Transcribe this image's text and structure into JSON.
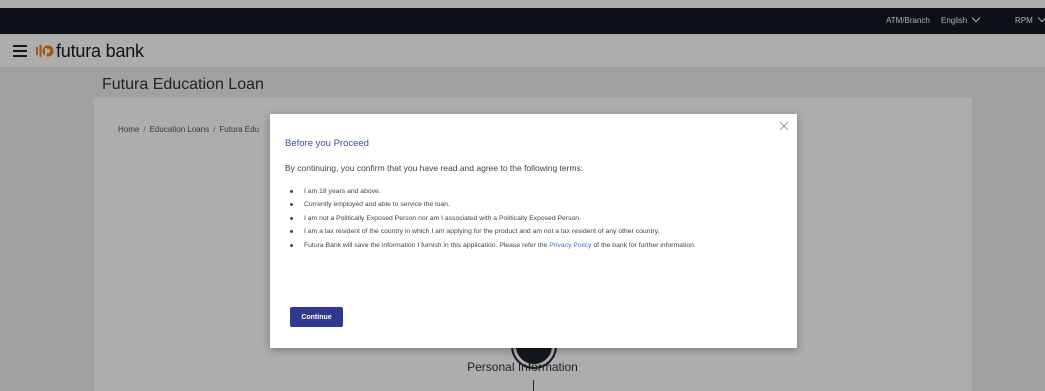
{
  "topbar": {
    "atm_branch": "ATM/Branch",
    "language": "English",
    "user": "RPM"
  },
  "header": {
    "brand": "futura bank"
  },
  "page": {
    "title": "Futura Education Loan",
    "breadcrumb": [
      "Home",
      "Education Loans",
      "Futura Edu"
    ]
  },
  "step": {
    "label": "Personal Information"
  },
  "modal": {
    "title": "Before you Proceed",
    "intro": "By continuing, you confirm that you have read and agree to the following terms:",
    "terms": [
      "I am 18 years and above.",
      "Currently employed and able to service the loan.",
      "I am not a Politically Exposed Person nor am I associated with a Politically Exposed Person.",
      "I am a tax resident of the country in which I am applying for the product and am not a tax resident of any other country."
    ],
    "privacy_term": {
      "before": "Futura Bank will save the information I furnish in this application. Please refer the ",
      "link": "Privacy Policy",
      "after": " of the bank for further information."
    },
    "continue_label": "Continue"
  },
  "colors": {
    "topbar_bg": "#161922",
    "accent": "#2f3a8f",
    "link": "#3d6fd6"
  },
  "icons": {
    "menu": "hamburger-icon",
    "logo": "futura-logo-icon",
    "close": "close-icon",
    "dropdown": "chevron-down-icon"
  }
}
